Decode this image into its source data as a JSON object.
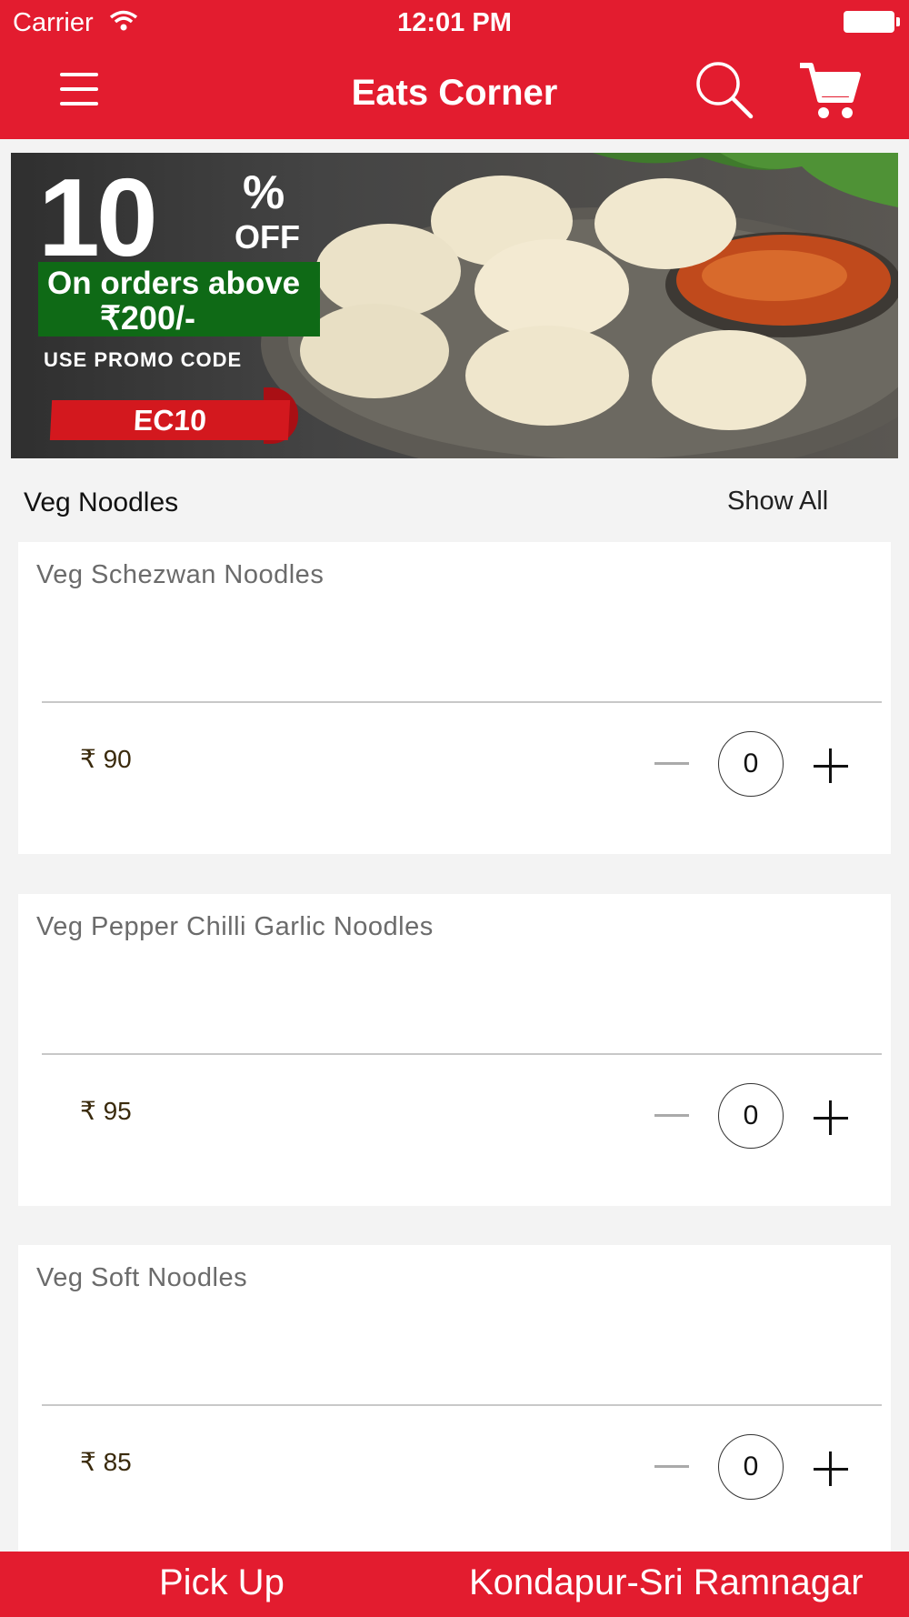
{
  "status_bar": {
    "carrier": "Carrier",
    "time": "12:01 PM"
  },
  "header": {
    "title": "Eats Corner",
    "menu_icon": "hamburger-menu-icon",
    "search_icon": "search-icon",
    "cart_icon": "cart-icon",
    "color": "#e31c2f"
  },
  "banner": {
    "discount_number": "10",
    "percent": "%",
    "off": "OFF",
    "line1": "On orders above",
    "line2": "₹200/-",
    "use_code": "USE PROMO CODE",
    "code": "EC10"
  },
  "section": {
    "title": "Veg Noodles",
    "show_all": "Show All"
  },
  "items": [
    {
      "name": "Veg Schezwan Noodles",
      "price": "₹ 90",
      "quantity": "0"
    },
    {
      "name": "Veg Pepper Chilli Garlic Noodles",
      "price": "₹ 95",
      "quantity": "0"
    },
    {
      "name": "Veg Soft Noodles",
      "price": "₹ 85",
      "quantity": "0"
    }
  ],
  "bottom_bar": {
    "mode": "Pick Up",
    "location": "Kondapur-Sri Ramnagar"
  }
}
